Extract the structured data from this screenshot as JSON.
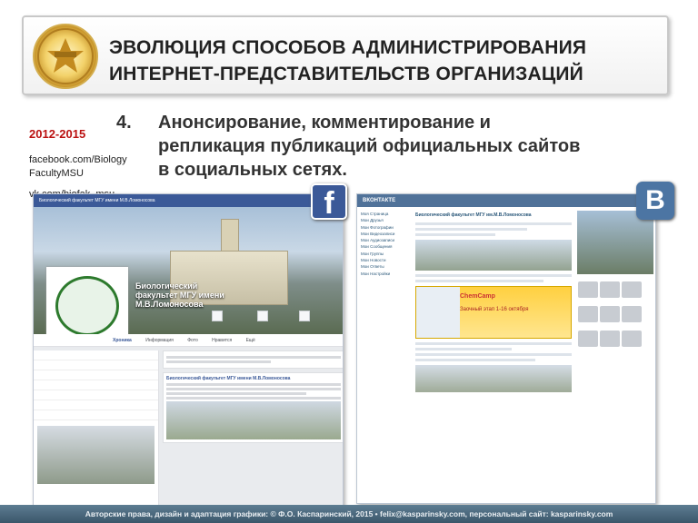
{
  "title": {
    "line1": "ЭВОЛЮЦИЯ СПОСОБОВ АДМИНИСТРИРОВАНИЯ",
    "line2": "ИНТЕРНЕТ-ПРЕДСТАВИТЕЛЬСТВ ОРГАНИЗАЦИЙ"
  },
  "side": {
    "years": "2012-2015",
    "links": [
      "facebook.com/Biology",
      "FacultyMSU",
      "vk.com/biofak_msu"
    ]
  },
  "point": {
    "number": "4.",
    "lines": [
      "Анонсирование, комментирование  и",
      "репликация публикаций официальных сайтов",
      "в социальных сетях."
    ]
  },
  "fb": {
    "topbar": "Биологический факультет МГУ имени М.В.Ломоносова",
    "name": [
      "Биологический",
      "факультет МГУ имени",
      "М.В.Ломоносова"
    ],
    "tabs": [
      "Хроника",
      "Информация",
      "Фото",
      "Нравится",
      "Ещё"
    ],
    "card1": "Биологический факультет МГУ имени М.В.Ломоносова"
  },
  "vk": {
    "topbar": "ВКОНТАКТЕ",
    "nav": [
      "Моя Страница",
      "Мои Друзья",
      "Мои Фотографии",
      "Мои Видеозаписи",
      "Мои Аудиозаписи",
      "Мои Сообщения",
      "Мои Группы",
      "Мои Новости",
      "Мои Ответы",
      "Мои Настройки"
    ],
    "head": "Биологический факультет МГУ им.М.В.Ломоносова",
    "chem_title": "ChemCamp",
    "chem_sub": "Заочный этап 1-16 октября"
  },
  "footer": "Авторские права, дизайн и адаптация графики: © Ф.О. Каспаринский, 2015  •  felix@kasparinsky.com, персональный сайт: kasparinsky.com",
  "colors": {
    "fb": "#3b5998",
    "vk": "#4c75a3",
    "years": "#bb1111"
  }
}
